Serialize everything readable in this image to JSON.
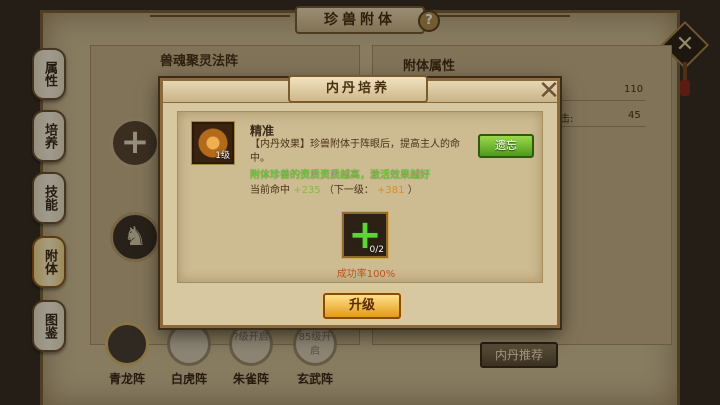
{
  "window": {
    "title": "珍兽附体",
    "help_icon": "?",
    "close_icon": "✕"
  },
  "side_tabs": [
    {
      "label": "属性",
      "active": false
    },
    {
      "label": "培养",
      "active": false
    },
    {
      "label": "技能",
      "active": false
    },
    {
      "label": "附体",
      "active": true
    },
    {
      "label": "图鉴",
      "active": false
    }
  ],
  "background": {
    "left_section_title": "兽魂聚灵法阵",
    "right_section_title": "附体属性",
    "stat_values": [
      "110",
      "45"
    ],
    "stat_fragments": [
      "击:"
    ],
    "recommend_button": "内丹推荐",
    "formations": [
      {
        "name": "青龙阵",
        "lock": "",
        "active": true
      },
      {
        "name": "白虎阵",
        "lock": "",
        "active": false
      },
      {
        "name": "朱雀阵",
        "lock": "?级开启",
        "active": false
      },
      {
        "name": "玄武阵",
        "lock": "85级开启",
        "active": false
      }
    ]
  },
  "dialog": {
    "title": "内丹培养",
    "close_icon": "✕",
    "item": {
      "name": "精准",
      "level": "1级",
      "description": "【内丹效果】珍兽附体于阵眼后，提高主人的命中。",
      "tip": "附体珍兽的资质资质越高，激活效果越好",
      "current_label": "当前命中",
      "current_value": "+235",
      "next_label": "（下一级：",
      "next_value": "+381",
      "next_close": "）"
    },
    "forget_button": "遗忘",
    "material": {
      "plus": "+",
      "count": "0/2"
    },
    "success_rate": "成功率100%",
    "upgrade_button": "升级"
  }
}
